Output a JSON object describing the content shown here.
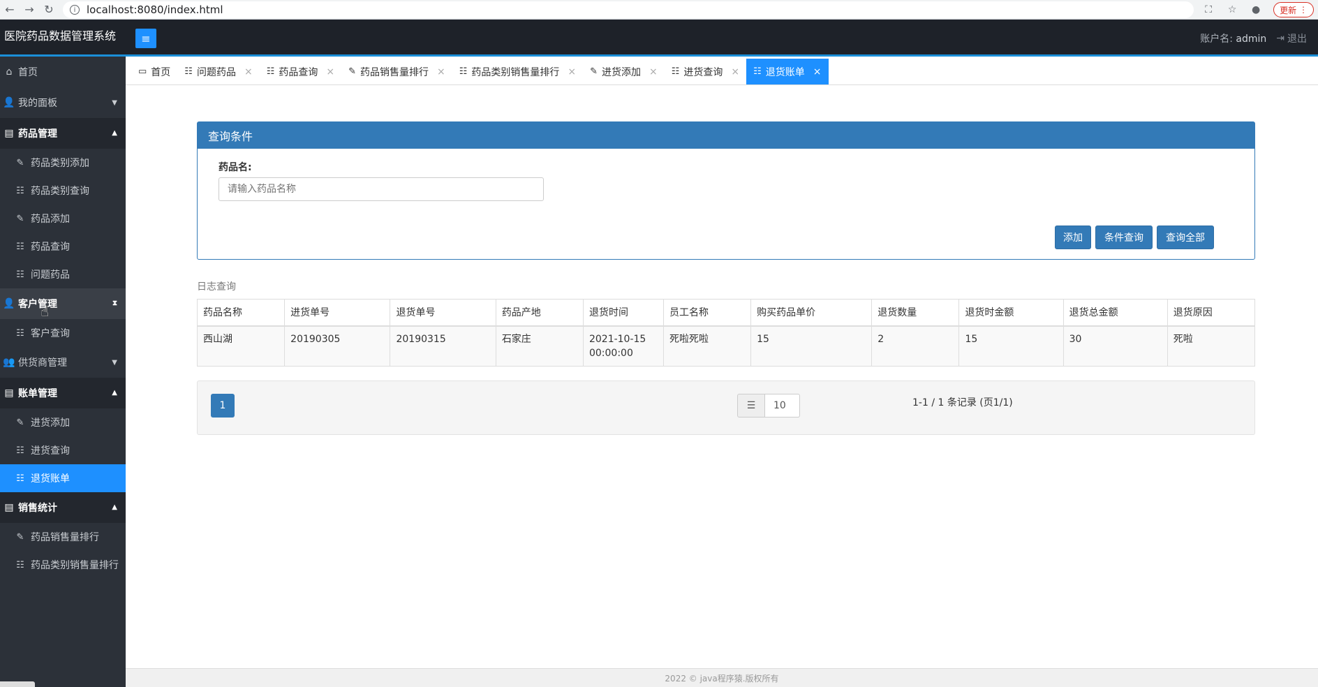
{
  "browser": {
    "url": "localhost:8080/index.html",
    "update_label": "更新"
  },
  "header": {
    "app_title": "医院药品数据管理系统",
    "account_label": "账户名:",
    "username": "admin",
    "logout_label": "退出"
  },
  "sidebar": {
    "home": "首页",
    "my_panel": "我的面板",
    "groups": [
      {
        "label": "药品管理",
        "items": [
          "药品类别添加",
          "药品类别查询",
          "药品添加",
          "药品查询",
          "问题药品"
        ]
      },
      {
        "label": "客户管理",
        "items": [
          "客户查询"
        ]
      },
      {
        "label": "供货商管理",
        "items": []
      },
      {
        "label": "账单管理",
        "items": [
          "进货添加",
          "进货查询",
          "退货账单"
        ]
      },
      {
        "label": "销售统计",
        "items": [
          "药品销售量排行",
          "药品类别销售量排行"
        ]
      }
    ]
  },
  "tabs": [
    "首页",
    "问题药品",
    "药品查询",
    "药品销售量排行",
    "药品类别销售量排行",
    "进货添加",
    "进货查询",
    "退货账单"
  ],
  "query": {
    "title": "查询条件",
    "field_label": "药品名:",
    "placeholder": "请输入药品名称",
    "add_label": "添加",
    "cond_label": "条件查询",
    "all_label": "查询全部"
  },
  "log_title": "日志查询",
  "table": {
    "headers": [
      "药品名称",
      "进货单号",
      "退货单号",
      "药品产地",
      "退货时间",
      "员工名称",
      "购买药品单价",
      "退货数量",
      "退货时金额",
      "退货总金额",
      "退货原因"
    ],
    "rows": [
      [
        "西山湖",
        "20190305",
        "20190315",
        "石家庄",
        "2021-10-15 00:00:00",
        "死啦死啦",
        "15",
        "2",
        "15",
        "30",
        "死啦"
      ]
    ]
  },
  "pager": {
    "current_page": "1",
    "page_size": "10",
    "records": "1-1 / 1 条记录 (页1/1)"
  },
  "footer": "2022 © java程序猿.版权所有",
  "colors": {
    "primary": "#337ab7",
    "accent": "#1e90ff",
    "sidebar_bg": "#2c3139",
    "header_bg": "#1e2229"
  }
}
